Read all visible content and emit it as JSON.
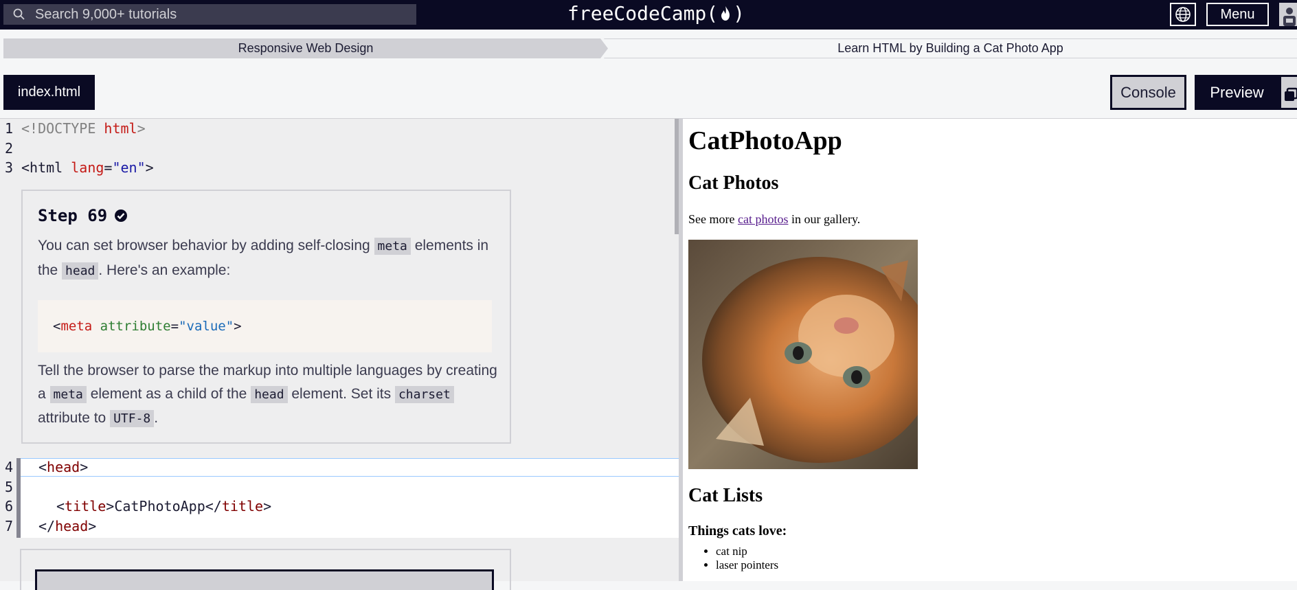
{
  "nav": {
    "search_placeholder": "Search 9,000+ tutorials",
    "logo_left": "freeCodeCamp(",
    "logo_right": ")",
    "menu_label": "Menu"
  },
  "breadcrumb": {
    "superblock": "Responsive Web Design",
    "block": "Learn HTML by Building a Cat Photo App"
  },
  "editor": {
    "file_tab": "index.html",
    "console_label": "Console",
    "preview_label": "Preview",
    "line_numbers": [
      "1",
      "2",
      "3",
      "4",
      "5",
      "6",
      "7"
    ],
    "lines": {
      "l1_open": "<!DOCTYPE ",
      "l1_html": "html",
      "l1_close": ">",
      "l3_open": "<html ",
      "l3_attr": "lang",
      "l3_eq": "=",
      "l3_val": "\"en\"",
      "l3_close": ">",
      "l4_lt": "<",
      "l4_tag": "head",
      "l4_gt": ">",
      "l6_lt": "<",
      "l6_tag": "title",
      "l6_gt": ">",
      "l6_text": "CatPhotoApp",
      "l6_lt2": "</",
      "l6_tag2": "title",
      "l6_gt2": ">",
      "l7_lt": "</",
      "l7_tag": "head",
      "l7_gt": ">"
    }
  },
  "step": {
    "title": "Step 69",
    "p1_a": "You can set browser behavior by adding self-closing ",
    "p1_code1": "meta",
    "p1_b": " elements in the ",
    "p1_code2": "head",
    "p1_c": ". Here's an example:",
    "ex_lt": "<",
    "ex_tag": "meta",
    "ex_attr": "attribute",
    "ex_eq": "=",
    "ex_val": "\"value\"",
    "ex_gt": ">",
    "p2_a": "Tell the browser to parse the markup into multiple languages by creating a ",
    "p2_code1": "meta",
    "p2_b": " element as a child of the ",
    "p2_code2": "head",
    "p2_c": " element. Set its ",
    "p2_code3": "charset",
    "p2_d": " attribute to ",
    "p2_code4": "UTF-8",
    "p2_e": "."
  },
  "preview": {
    "h1": "CatPhotoApp",
    "h2": "Cat Photos",
    "para_before": "See more ",
    "para_link": "cat photos",
    "para_after": " in our gallery.",
    "h2b": "Cat Lists",
    "h3": "Things cats love:",
    "list": [
      "cat nip",
      "laser pointers"
    ]
  },
  "colors": {
    "nav_bg": "#0a0a23",
    "accent_blue": "#99c9ff"
  }
}
